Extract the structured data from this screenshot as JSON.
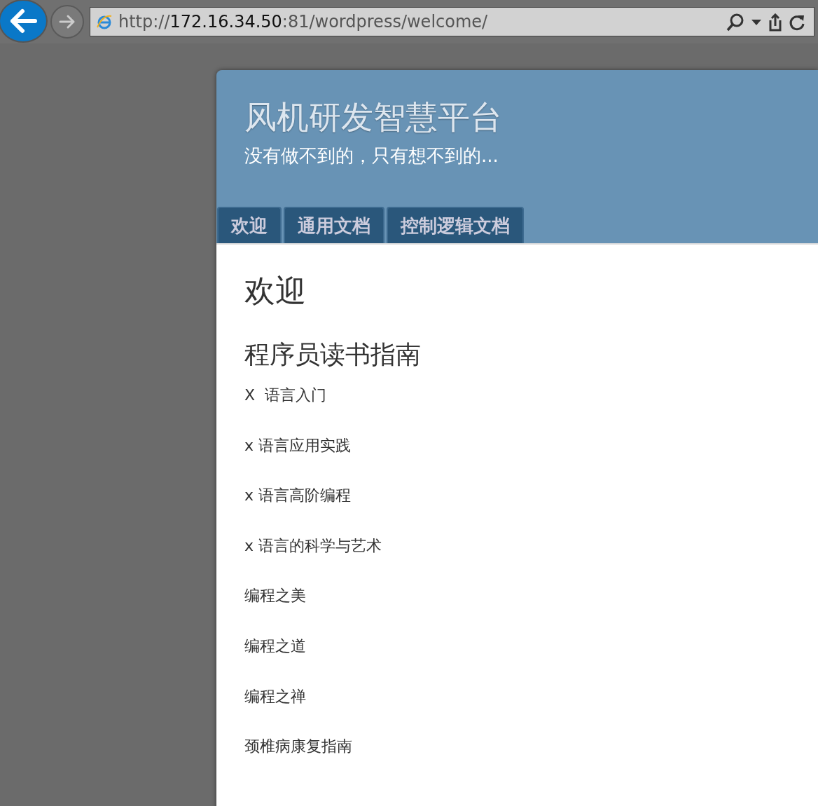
{
  "browser": {
    "address": {
      "scheme": "http://",
      "host": "172.16.34.50",
      "path": ":81/wordpress/welcome/"
    }
  },
  "site": {
    "title": "风机研发智慧平台",
    "tagline": "没有做不到的，只有想不到的..."
  },
  "tabs": [
    {
      "label": "欢迎"
    },
    {
      "label": "通用文档"
    },
    {
      "label": "控制逻辑文档"
    }
  ],
  "content": {
    "page_title": "欢迎",
    "section_title": "程序员读书指南",
    "items": [
      "X  语言入门",
      "x 语言应用实践",
      "x 语言高阶编程",
      "x 语言的科学与艺术",
      "编程之美",
      "编程之道",
      "编程之禅",
      "颈椎病康复指南"
    ]
  }
}
